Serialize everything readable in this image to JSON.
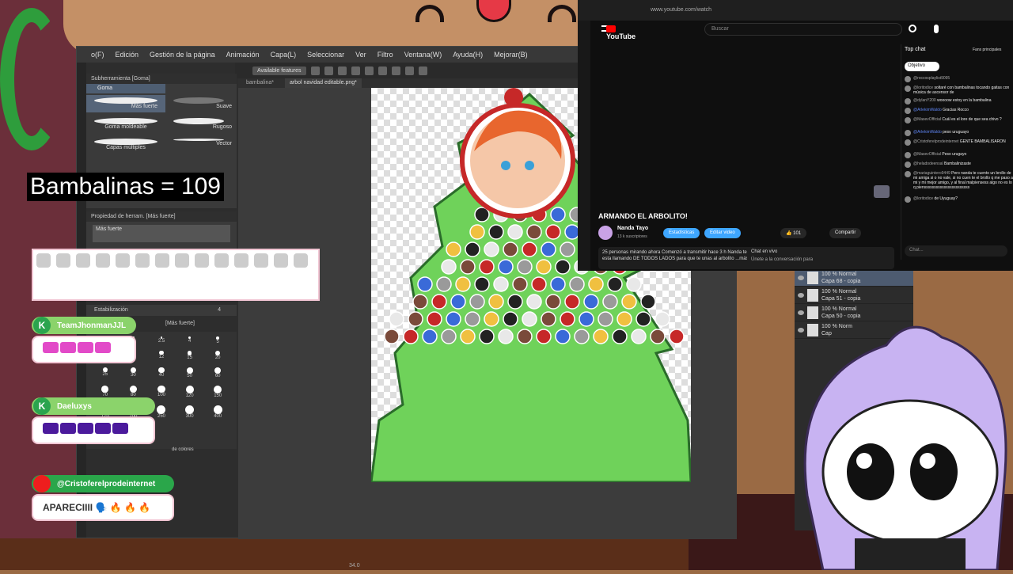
{
  "counter": {
    "label": "Bambalinas = 109"
  },
  "app": {
    "menu": [
      "o(F)",
      "Edición",
      "Gestión de la página",
      "Animación",
      "Capa(L)",
      "Seleccionar",
      "Ver",
      "Filtro",
      "Ventana(W)",
      "Ayuda(H)",
      "Mejorar(B)"
    ],
    "toolbar_chip": "Available features",
    "subtool_title": "Subherramienta [Goma]",
    "active_tab": "Goma",
    "brushes": [
      "Más fuerte",
      "Suave",
      "Goma moldeable",
      "Rugoso",
      "Capas múltiples",
      "Vector"
    ],
    "prop_title": "Propiedad de herram. [Más fuerte]",
    "prop_preset": "Más fuerte",
    "stabilization": "Estabilización",
    "stabilization_value": "4",
    "brush_size_header": "[Más fuerte]",
    "brush_sizes": [
      "1.5",
      "2",
      "2.5",
      "4",
      "5",
      "7",
      "10",
      "12",
      "15",
      "20",
      "25",
      "30",
      "40",
      "50",
      "60",
      "70",
      "80",
      "100",
      "120",
      "150",
      "170",
      "200",
      "250",
      "300",
      "400",
      "500"
    ],
    "color_label": "de colores",
    "doc_tabs": [
      "bambalina*",
      "arbol navidad editable.png*"
    ],
    "zoom_value": "34.0",
    "layers": [
      {
        "mode": "100 % Normal",
        "name": "Capa 68 - copia"
      },
      {
        "mode": "100 % Normal",
        "name": "Capa 51 - copia"
      },
      {
        "mode": "100 % Normal",
        "name": "Capa 50 - copia"
      },
      {
        "mode": "100 % Norm",
        "name": "Cap"
      },
      {
        "mode": "",
        "name": ""
      }
    ]
  },
  "youtube": {
    "url": "www.youtube.com/watch",
    "logo": "YouTube",
    "search_placeholder": "Buscar",
    "video_title": "ARMANDO EL ARBOLITO!",
    "channel_name": "Nanda Tayo",
    "channel_subs": "13 k suscriptores",
    "btn_stats": "Estadísticas",
    "btn_edit": "Editar video",
    "likes": "101",
    "btn_share": "Compartir",
    "desc": "25 personas mirando ahora  Comenzó a transmitir hace 3 h Nanda te esta llamando DE TODOS LADOS para que te unas al arbolito ...más",
    "live_chat_label": "Chat en vivo",
    "live_chat_join": "Únete a la conversación para",
    "chat_header": "Top chat",
    "chat_filter": "Fans principales",
    "chat_tag": "Objetivo",
    "chat_input": "Chat...",
    "chat": [
      {
        "author": "@roccosplaylist9095",
        "msg": ""
      },
      {
        "author": "@loritodice",
        "msg": "soltaré con bambalinas tocando gaitas con música de ascensor de"
      },
      {
        "author": "@dylanY200",
        "msg": "woooow estoy en la bambalina"
      },
      {
        "author": "@ArlekimWaldo",
        "msg": "Gracias Rocco",
        "mod": true
      },
      {
        "author": "@MasevOfficial",
        "msg": "Cuál es el lore de que sea chivo ?"
      },
      {
        "author": "@ArlekimWaldo",
        "msg": "peso uruguayo",
        "mod": true
      },
      {
        "author": "@Cristoferelprodeinternet",
        "msg": "GENTE BAMBALISARON"
      },
      {
        "author": "@MasevOfficial",
        "msg": "Peso urugayo"
      },
      {
        "author": "@heladodeensal",
        "msg": "Bambalinizaste"
      },
      {
        "author": "@mariaguintero9449",
        "msg": "Pero nanda te cuento un brollo de mi amiga si o no vale, si no cuen te el brollo q me paso a mi y mi mejor amigo, y al final malpiensess algo no es lo q piensssssssssssssssssssssss"
      },
      {
        "author": "@loritodice",
        "msg": "de Uyuguay?"
      }
    ]
  },
  "overlay_chat": [
    {
      "user": "TeamJhonmanJJL",
      "emote_color": "#e24ac8",
      "emote_count": 4
    },
    {
      "user": "Daeluxys",
      "emote_color": "#4b1a9c",
      "emote_count": 5
    }
  ],
  "yt_chatter": {
    "user": "@Cristoferelprodeinternet",
    "msg": "APARECIIII 🗣️ 🔥 🔥 🔥"
  },
  "colors": {
    "tree": "#6fd25a",
    "tree_outline": "#2a6b2a",
    "accent": "#3ea6ff"
  }
}
